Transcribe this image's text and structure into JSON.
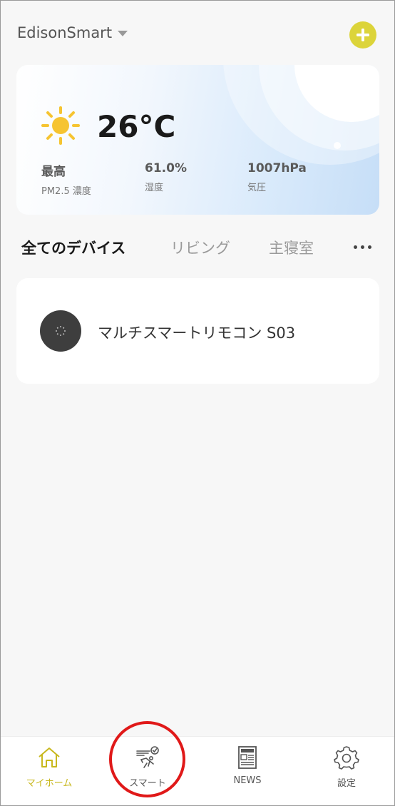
{
  "header": {
    "home_name": "EdisonSmart",
    "add_icon": "plus-icon",
    "accent_color": "#dcd43a"
  },
  "weather": {
    "icon": "sun-icon",
    "temperature": "26°C",
    "stats": [
      {
        "value": "最高",
        "label": "PM2.5 濃度"
      },
      {
        "value": "61.0%",
        "label": "湿度"
      },
      {
        "value": "1007hPa",
        "label": "気圧"
      }
    ]
  },
  "tabs": [
    {
      "label": "全てのデバイス",
      "active": true
    },
    {
      "label": "リビング",
      "active": false
    },
    {
      "label": "主寝室",
      "active": false
    }
  ],
  "more_icon": "more-dots-icon",
  "devices": [
    {
      "name": "マルチスマートリモコン S03",
      "icon": "ir-remote-icon"
    }
  ],
  "bottom_nav": [
    {
      "label": "マイホーム",
      "icon": "home-icon",
      "active": true
    },
    {
      "label": "スマート",
      "icon": "smart-scene-icon",
      "active": false
    },
    {
      "label": "NEWS",
      "icon": "news-icon",
      "active": false
    },
    {
      "label": "設定",
      "icon": "gear-icon",
      "active": false
    }
  ],
  "highlight_color": "#e01919"
}
